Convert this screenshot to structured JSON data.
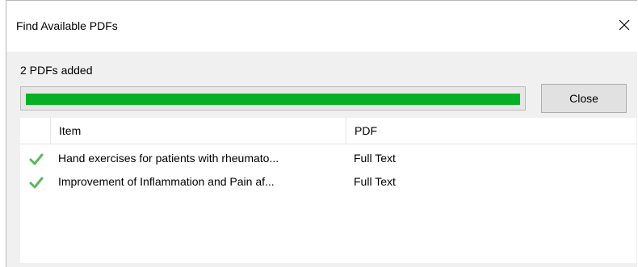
{
  "window": {
    "title": "Find Available PDFs",
    "close_icon": "close-icon"
  },
  "status": {
    "text": "2 PDFs added",
    "progress_fraction": 1.0,
    "progress_color": "#06b025"
  },
  "buttons": {
    "close_label": "Close"
  },
  "list": {
    "columns": [
      "Item",
      "PDF"
    ],
    "rows": [
      {
        "status_icon": "checkmark-icon",
        "item": "Hand exercises for patients with rheumato...",
        "pdf": "Full Text"
      },
      {
        "status_icon": "checkmark-icon",
        "item": "Improvement of Inflammation and Pain af...",
        "pdf": "Full Text"
      }
    ]
  }
}
